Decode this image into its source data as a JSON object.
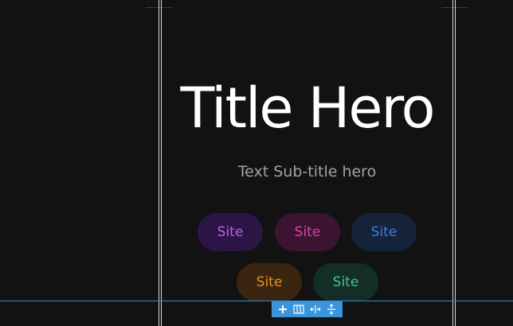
{
  "hero": {
    "title": "Title Hero",
    "subtitle": "Text Sub-title hero"
  },
  "buttons": [
    {
      "label": "Site",
      "text_color": "#c15cf4",
      "bg_color": "#2c1446"
    },
    {
      "label": "Site",
      "text_color": "#e040a8",
      "bg_color": "#3a1430"
    },
    {
      "label": "Site",
      "text_color": "#3b7cf2",
      "bg_color": "#14233a"
    },
    {
      "label": "Site",
      "text_color": "#f08a1e",
      "bg_color": "#3a2610"
    },
    {
      "label": "Site",
      "text_color": "#45c29a",
      "bg_color": "#122e27"
    }
  ],
  "toolbar": {
    "icons": [
      "plus-icon",
      "columns-icon",
      "horizontal-resize-icon",
      "vertical-resize-icon"
    ],
    "accent": "#3a95dc"
  },
  "colors": {
    "background": "#121212",
    "title": "#ffffff",
    "subtitle": "#a3a3a3",
    "guide": "#2f8fd8"
  }
}
